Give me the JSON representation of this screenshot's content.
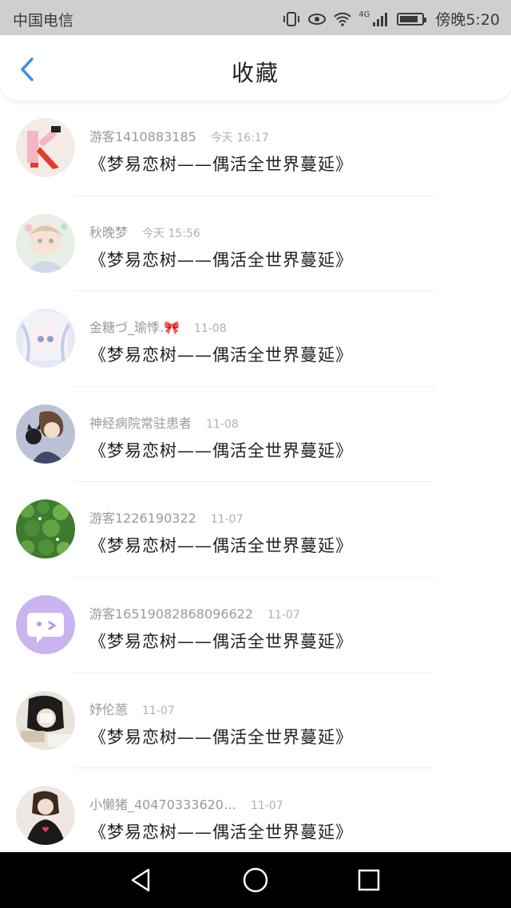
{
  "status_bar": {
    "carrier": "中国电信",
    "network": "4G",
    "time": "傍晚5:20",
    "battery_level": 0.85
  },
  "header": {
    "title": "收藏"
  },
  "favorites": [
    {
      "user": "游客1410883185",
      "time": "今天 16:17",
      "book": "《梦易恋树——偶活全世界蔓延》"
    },
    {
      "user": "秋晚梦",
      "time": "今天 15:56",
      "book": "《梦易恋树——偶活全世界蔓延》"
    },
    {
      "user": "金糖づ_瑜悸.🎀",
      "time": "11-08",
      "book": "《梦易恋树——偶活全世界蔓延》"
    },
    {
      "user": "神经病院常驻患者",
      "time": "11-08",
      "book": "《梦易恋树——偶活全世界蔓延》"
    },
    {
      "user": "游客1226190322",
      "time": "11-07",
      "book": "《梦易恋树——偶活全世界蔓延》"
    },
    {
      "user": "游客16519082868096622",
      "time": "11-07",
      "book": "《梦易恋树——偶活全世界蔓延》"
    },
    {
      "user": "妤伦蒽",
      "time": "11-07",
      "book": "《梦易恋树——偶活全世界蔓延》"
    },
    {
      "user": "小懒猪_40470333620…",
      "time": "11-07",
      "book": "《梦易恋树——偶活全世界蔓延》"
    }
  ],
  "colors": {
    "accent": "#2f8ff0",
    "status_bar": "#cfcfcf",
    "nav_bar": "#000000"
  }
}
